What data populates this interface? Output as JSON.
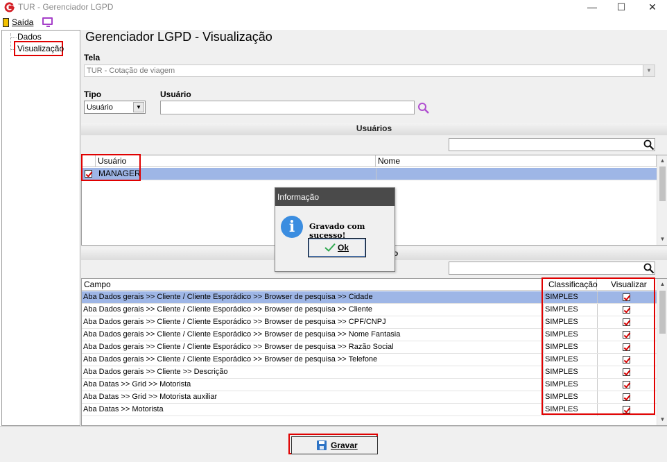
{
  "window": {
    "title": "TUR - Gerenciador LGPD",
    "minimize_glyph": "—",
    "maximize_glyph": "☐",
    "close_glyph": "✕"
  },
  "menu": {
    "exit_label": "Saída",
    "icons": [
      "door-icon",
      "monitor-icon"
    ]
  },
  "tree": {
    "items": [
      {
        "label": "Dados"
      },
      {
        "label": "Visualização",
        "selected": true
      }
    ]
  },
  "page": {
    "heading": "Gerenciador LGPD - Visualização",
    "tela_label": "Tela",
    "tela_value": "TUR - Cotação de viagem",
    "tipo_label": "Tipo",
    "tipo_value": "Usuário",
    "usuario_label": "Usuário",
    "usuario_value": ""
  },
  "users_section": {
    "title": "Usuários",
    "search_value": "",
    "columns": [
      "Usuário",
      "Nome"
    ],
    "rows": [
      {
        "checked": true,
        "usuario": "MANAGER",
        "nome": ""
      }
    ]
  },
  "fields_section": {
    "title_visible_suffix": "o",
    "search_value": "",
    "columns": [
      "Campo",
      "Classificação",
      "Visualizar"
    ],
    "rows": [
      {
        "campo": "Aba Dados gerais >> Cliente / Cliente Esporádico >> Browser de pesquisa >> Cidade",
        "classificacao": "SIMPLES",
        "visualizar": true
      },
      {
        "campo": "Aba Dados gerais >> Cliente / Cliente Esporádico >> Browser de pesquisa >> Cliente",
        "classificacao": "SIMPLES",
        "visualizar": true
      },
      {
        "campo": "Aba Dados gerais >> Cliente / Cliente Esporádico >> Browser de pesquisa >> CPF/CNPJ",
        "classificacao": "SIMPLES",
        "visualizar": true
      },
      {
        "campo": "Aba Dados gerais >> Cliente / Cliente Esporádico >> Browser de pesquisa >> Nome Fantasia",
        "classificacao": "SIMPLES",
        "visualizar": true
      },
      {
        "campo": "Aba Dados gerais >> Cliente / Cliente Esporádico >> Browser de pesquisa >> Razão Social",
        "classificacao": "SIMPLES",
        "visualizar": true
      },
      {
        "campo": "Aba Dados gerais >> Cliente / Cliente Esporádico >> Browser de pesquisa >> Telefone",
        "classificacao": "SIMPLES",
        "visualizar": true
      },
      {
        "campo": "Aba Dados gerais >> Cliente >> Descrição",
        "classificacao": "SIMPLES",
        "visualizar": true
      },
      {
        "campo": "Aba Datas >> Grid >> Motorista",
        "classificacao": "SIMPLES",
        "visualizar": true
      },
      {
        "campo": "Aba Datas >> Grid >> Motorista auxiliar",
        "classificacao": "SIMPLES",
        "visualizar": true
      },
      {
        "campo": "Aba Datas >> Motorista",
        "classificacao": "SIMPLES",
        "visualizar": true
      }
    ]
  },
  "dialog": {
    "title": "Informação",
    "message": "Gravado com sucesso!",
    "ok_label": "Ok",
    "icon": "info-icon"
  },
  "footer": {
    "save_label": "Gravar"
  },
  "colors": {
    "highlight_red": "#e00000",
    "selected_row": "#9eb6e6",
    "dialog_title_bg": "#4a4a4a",
    "info_blue": "#3b8de0",
    "brand_red": "#d42027",
    "search_purple": "#b04fd0"
  }
}
